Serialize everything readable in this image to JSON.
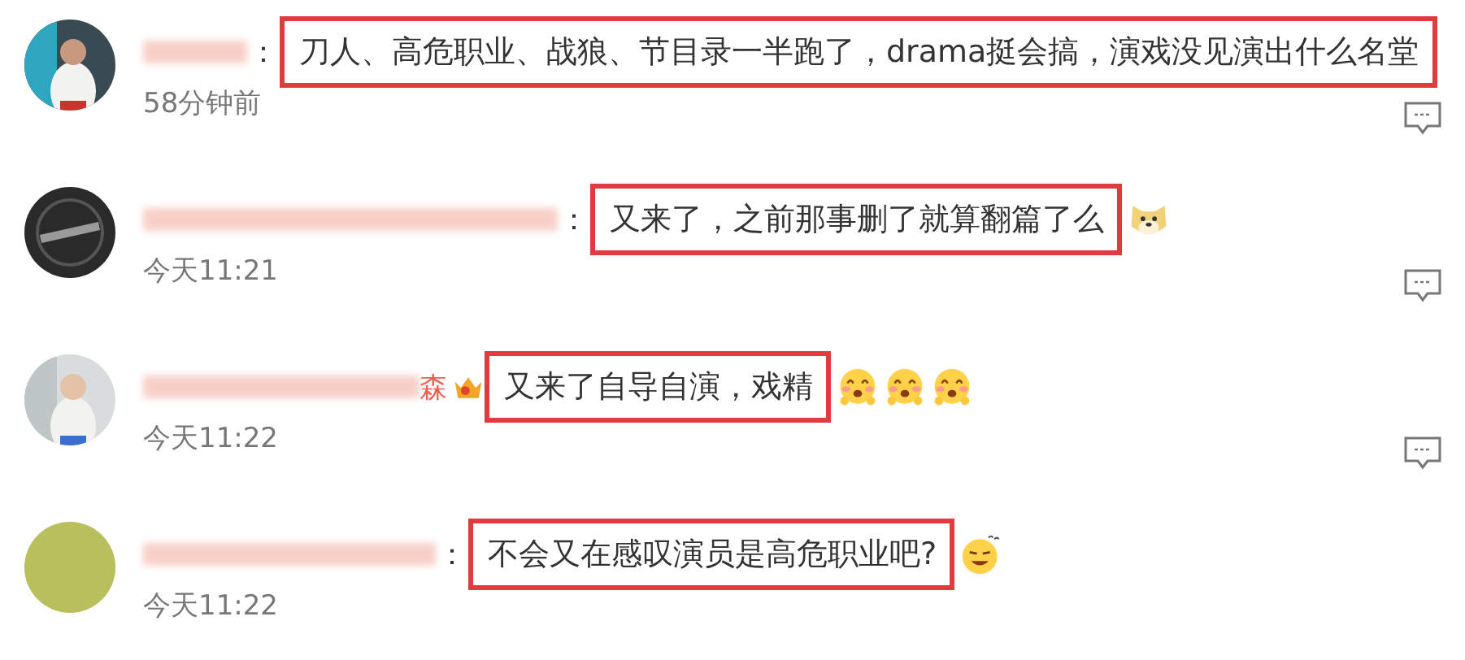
{
  "comments": [
    {
      "avatar": {
        "kind": "picture"
      },
      "crown_badge": false,
      "separator": "：",
      "text": "刀人、高危职业、战狼、节目录一半跑了，drama挺会搞，演戏没见演出什么名堂",
      "highlighted": true,
      "time": "58分钟前",
      "reply_icon": true
    },
    {
      "avatar": {
        "kind": "logo"
      },
      "crown_badge": false,
      "separator": "：",
      "text": "又来了，之前那事删了就算翻篇了么",
      "highlighted": true,
      "emojis": [
        {
          "kind": "doge"
        }
      ],
      "time": "今天11:21",
      "reply_icon": true
    },
    {
      "avatar": {
        "kind": "picture"
      },
      "name_visible": "森",
      "crown_badge": true,
      "text": "又来了自导自演，戏精",
      "highlighted": true,
      "emojis": [
        {
          "kind": "blush"
        },
        {
          "kind": "blush"
        },
        {
          "kind": "blush"
        }
      ],
      "time": "今天11:22",
      "reply_icon": true
    },
    {
      "avatar": {
        "kind": "plain",
        "color": "#b9bf5c"
      },
      "crown_badge": false,
      "separator": "：",
      "text": "不会又在感叹演员是高危职业吧?",
      "highlighted": true,
      "emojis": [
        {
          "kind": "dizzy"
        }
      ],
      "time": "今天11:22",
      "reply_icon": false
    }
  ]
}
